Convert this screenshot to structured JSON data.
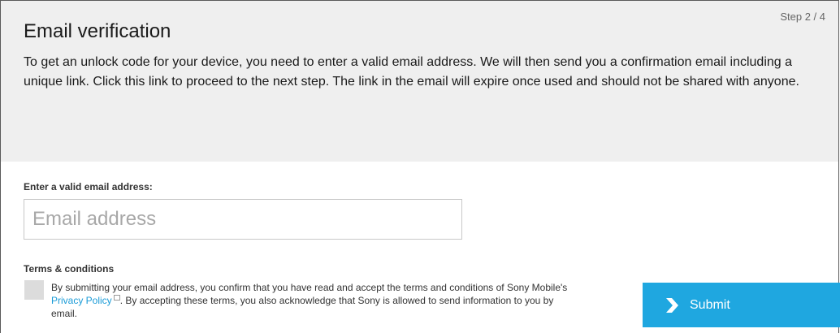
{
  "step": "Step 2 / 4",
  "title": "Email verification",
  "description": "To get an unlock code for your device, you need to enter a valid email address. We will then send you a confirmation email including a unique link. Click this link to proceed to the next step. The link in the email will expire once used and should not be shared with anyone.",
  "email": {
    "label": "Enter a valid email address:",
    "placeholder": "Email address",
    "value": ""
  },
  "terms": {
    "title": "Terms & conditions",
    "text_before": "By submitting your email address, you confirm that you have read and accept the terms and conditions of Sony Mobile's ",
    "link": "Privacy Policy",
    "text_after": ". By accepting these terms, you also acknowledge that Sony is allowed to send information to you by email.",
    "checked": false
  },
  "submit": {
    "label": "Submit",
    "icon": "chevron-right-icon"
  },
  "colors": {
    "accent": "#1fa7e0",
    "link": "#1a9bd7",
    "header_bg": "#efefef"
  }
}
